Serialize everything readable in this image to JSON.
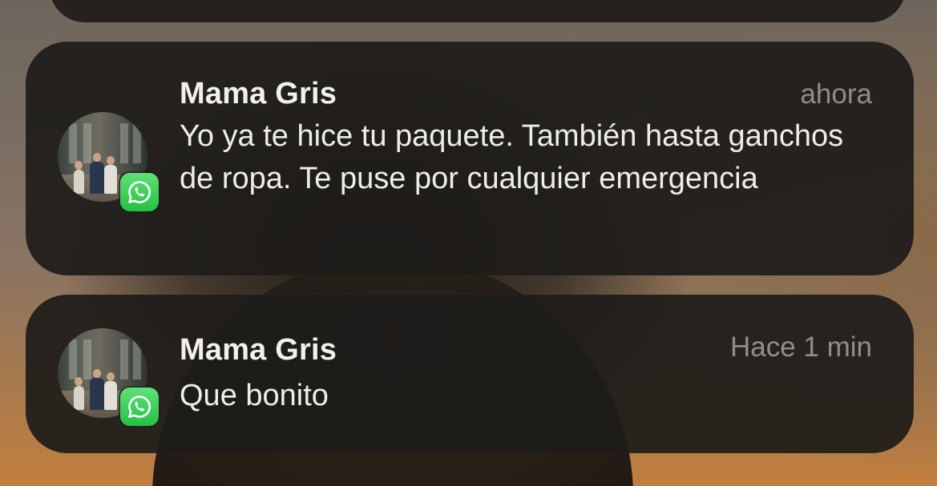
{
  "notifications": [
    {
      "sender": "Mama Gris",
      "time": "ahora",
      "message": "Yo ya te hice tu paquete. También hasta ganchos de ropa. Te puse por cualquier emergencia",
      "app_icon": "whatsapp-icon",
      "app_color": "#25C046"
    },
    {
      "sender": "Mama Gris",
      "time": "Hace 1 min",
      "message": "Que bonito",
      "app_icon": "whatsapp-icon",
      "app_color": "#25C046"
    }
  ]
}
